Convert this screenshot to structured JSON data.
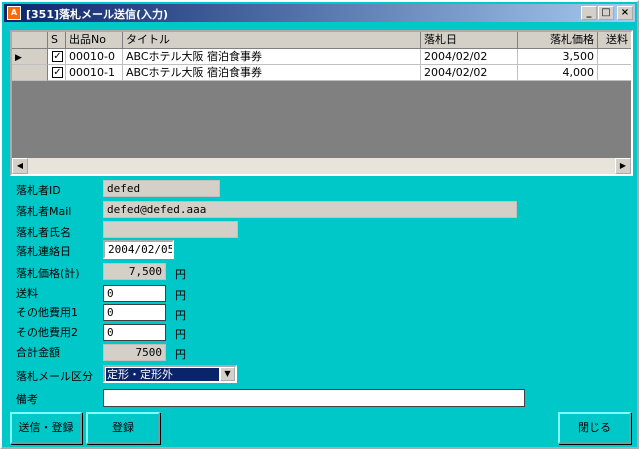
{
  "window": {
    "title": "[351]落札メール送信(入力)",
    "app_icon": "app-icon",
    "controls": {
      "minimize": "_",
      "maximize": "□",
      "close": "×"
    }
  },
  "grid": {
    "columns": [
      "S",
      "出品No",
      "タイトル",
      "落札日",
      "落札価格",
      "送料"
    ],
    "rows": [
      {
        "selected": true,
        "checked": true,
        "item_no": "00010-0",
        "title": "ABCホテル大阪 宿泊食事券",
        "date": "2004/02/02",
        "price": "3,500",
        "shipping": ""
      },
      {
        "selected": false,
        "checked": true,
        "item_no": "00010-1",
        "title": "ABCホテル大阪 宿泊食事券",
        "date": "2004/02/02",
        "price": "4,000",
        "shipping": ""
      }
    ],
    "row_pointer": "▶",
    "scroll_left": "◀",
    "scroll_right": "▶"
  },
  "form": {
    "bidder_id": {
      "label": "落札者ID",
      "value": "defed"
    },
    "bidder_mail": {
      "label": "落札者Mail",
      "value": "defed@defed.aaa"
    },
    "bidder_name": {
      "label": "落札者氏名",
      "value": ""
    },
    "contact_date": {
      "label": "落札連絡日",
      "value": "2004/02/05"
    },
    "total_price": {
      "label": "落札価格(計)",
      "value": "7,500",
      "unit": "円"
    },
    "shipping": {
      "label": "送料",
      "value": "0",
      "unit": "円"
    },
    "other_fee1": {
      "label": "その他費用1",
      "value": "0",
      "unit": "円"
    },
    "other_fee2": {
      "label": "その他費用2",
      "value": "0",
      "unit": "円"
    },
    "grand_total": {
      "label": "合計金額",
      "value": "7500",
      "unit": "円"
    },
    "mail_type": {
      "label": "落札メール区分",
      "value": "定形・定形外"
    },
    "remarks": {
      "label": "備考",
      "value": ""
    }
  },
  "buttons": {
    "send_register": "送信・登録",
    "register": "登録",
    "close": "閉じる"
  }
}
